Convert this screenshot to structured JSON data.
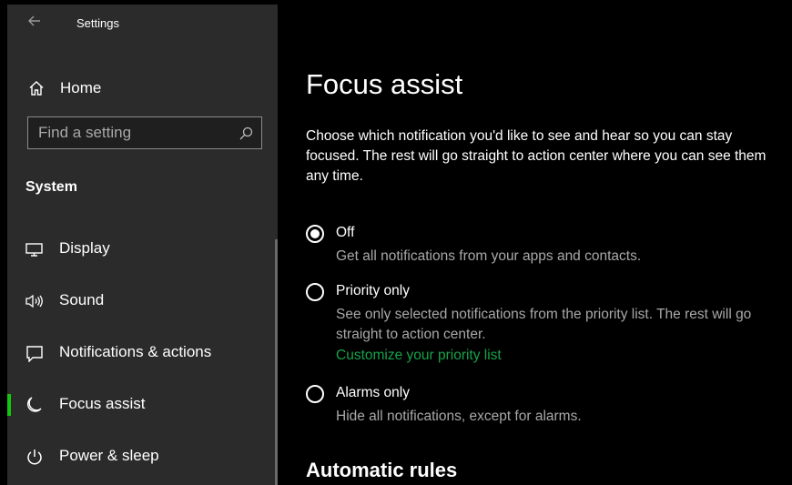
{
  "window": {
    "title": "Settings"
  },
  "sidebar": {
    "home_label": "Home",
    "search_placeholder": "Find a setting",
    "section_label": "System",
    "items": [
      {
        "label": "Display",
        "icon": "monitor-icon"
      },
      {
        "label": "Sound",
        "icon": "speaker-icon"
      },
      {
        "label": "Notifications & actions",
        "icon": "message-icon"
      },
      {
        "label": "Focus assist",
        "icon": "moon-icon",
        "active": true
      },
      {
        "label": "Power & sleep",
        "icon": "power-icon"
      }
    ]
  },
  "main": {
    "title": "Focus assist",
    "intro": "Choose which notification you'd like to see and hear so you can stay focused. The rest will go straight to action center where you can see them any time.",
    "options": [
      {
        "label": "Off",
        "description": "Get all notifications from your apps and contacts.",
        "selected": true
      },
      {
        "label": "Priority only",
        "description": "See only selected notifications from the priority list. The rest will go straight to action center.",
        "link": "Customize your priority list",
        "selected": false
      },
      {
        "label": "Alarms only",
        "description": "Hide all notifications, except for alarms.",
        "selected": false
      }
    ],
    "subheading": "Automatic rules"
  },
  "colors": {
    "accent": "#16c60c",
    "link": "#16a34a",
    "sidebar_bg": "#2b2b2b",
    "main_bg": "#000000"
  }
}
